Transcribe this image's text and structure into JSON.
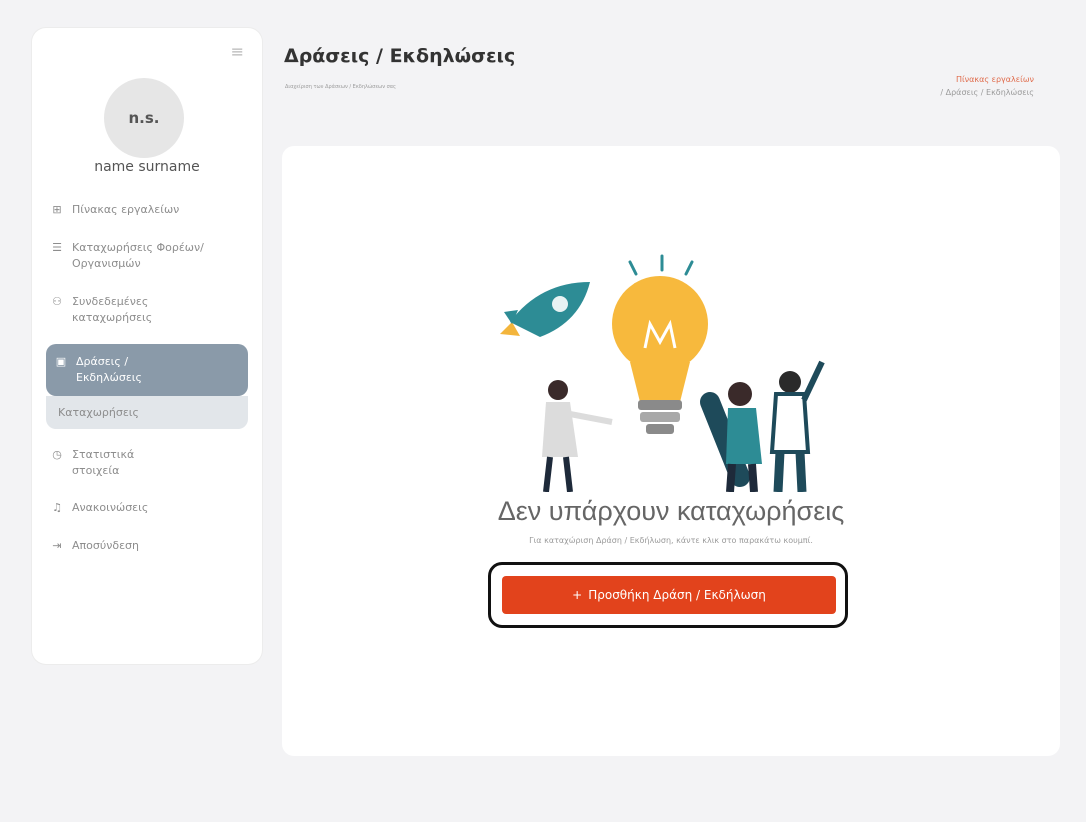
{
  "user": {
    "initials": "n.s.",
    "name": "name surname"
  },
  "sidebar": {
    "items": [
      {
        "icon": "grid-icon",
        "label": "Πίνακας εργαλείων"
      },
      {
        "icon": "list-icon",
        "label": "Καταχωρήσεις Φορέων/Οργανισμών"
      },
      {
        "icon": "users-link-icon",
        "label": "Συνδεδεμένες καταχωρήσεις"
      },
      {
        "icon": "calendar-icon",
        "label": "Δράσεις / Εκδηλώσεις",
        "active": true
      },
      {
        "label": "Καταχωρήσεις",
        "sub": true
      },
      {
        "icon": "clock-icon",
        "label": "Στατιστικά στοιχεία"
      },
      {
        "icon": "bell-icon",
        "label": "Ανακοινώσεις"
      },
      {
        "icon": "logout-icon",
        "label": "Αποσύνδεση"
      }
    ]
  },
  "header": {
    "title": "Δράσεις / Εκδηλώσεις",
    "subtitle": "Διαχείριση των Δράσεων / Εκδηλώσεων σας",
    "breadcrumb": {
      "link": "Πίνακας εργαλείων",
      "current": "/ Δράσεις / Εκδηλώσεις"
    }
  },
  "empty_state": {
    "title": "Δεν υπάρχουν καταχωρήσεις",
    "hint": "Για καταχώριση Δράση / Εκδήλωση, κάντε κλικ στο παρακάτω κουμπί.",
    "button_label": "Προσθήκη Δράση / Εκδήλωση",
    "button_icon": "plus-icon"
  },
  "colors": {
    "accent": "#e2431c",
    "active_nav": "#8a9aa9",
    "breadcrumb_link": "#e06b4b"
  }
}
